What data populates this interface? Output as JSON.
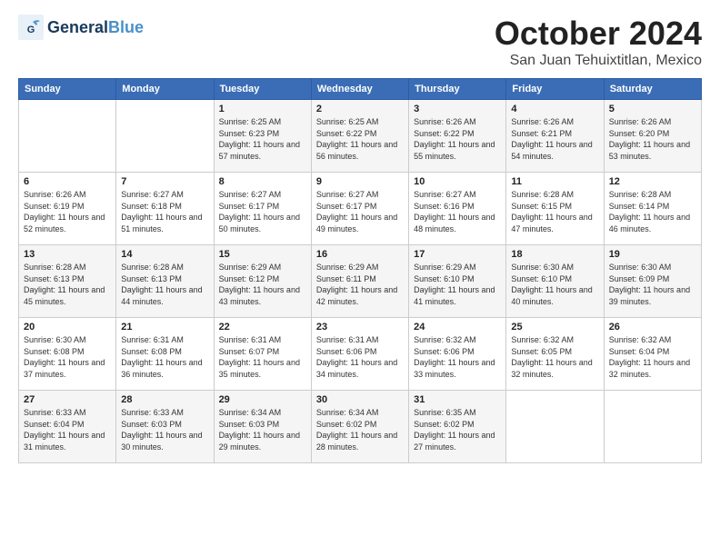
{
  "header": {
    "logo_general": "General",
    "logo_blue": "Blue",
    "month": "October 2024",
    "location": "San Juan Tehuixtitlan, Mexico"
  },
  "days_of_week": [
    "Sunday",
    "Monday",
    "Tuesday",
    "Wednesday",
    "Thursday",
    "Friday",
    "Saturday"
  ],
  "weeks": [
    [
      {
        "day": "",
        "info": ""
      },
      {
        "day": "",
        "info": ""
      },
      {
        "day": "1",
        "info": "Sunrise: 6:25 AM\nSunset: 6:23 PM\nDaylight: 11 hours and 57 minutes."
      },
      {
        "day": "2",
        "info": "Sunrise: 6:25 AM\nSunset: 6:22 PM\nDaylight: 11 hours and 56 minutes."
      },
      {
        "day": "3",
        "info": "Sunrise: 6:26 AM\nSunset: 6:22 PM\nDaylight: 11 hours and 55 minutes."
      },
      {
        "day": "4",
        "info": "Sunrise: 6:26 AM\nSunset: 6:21 PM\nDaylight: 11 hours and 54 minutes."
      },
      {
        "day": "5",
        "info": "Sunrise: 6:26 AM\nSunset: 6:20 PM\nDaylight: 11 hours and 53 minutes."
      }
    ],
    [
      {
        "day": "6",
        "info": "Sunrise: 6:26 AM\nSunset: 6:19 PM\nDaylight: 11 hours and 52 minutes."
      },
      {
        "day": "7",
        "info": "Sunrise: 6:27 AM\nSunset: 6:18 PM\nDaylight: 11 hours and 51 minutes."
      },
      {
        "day": "8",
        "info": "Sunrise: 6:27 AM\nSunset: 6:17 PM\nDaylight: 11 hours and 50 minutes."
      },
      {
        "day": "9",
        "info": "Sunrise: 6:27 AM\nSunset: 6:17 PM\nDaylight: 11 hours and 49 minutes."
      },
      {
        "day": "10",
        "info": "Sunrise: 6:27 AM\nSunset: 6:16 PM\nDaylight: 11 hours and 48 minutes."
      },
      {
        "day": "11",
        "info": "Sunrise: 6:28 AM\nSunset: 6:15 PM\nDaylight: 11 hours and 47 minutes."
      },
      {
        "day": "12",
        "info": "Sunrise: 6:28 AM\nSunset: 6:14 PM\nDaylight: 11 hours and 46 minutes."
      }
    ],
    [
      {
        "day": "13",
        "info": "Sunrise: 6:28 AM\nSunset: 6:13 PM\nDaylight: 11 hours and 45 minutes."
      },
      {
        "day": "14",
        "info": "Sunrise: 6:28 AM\nSunset: 6:13 PM\nDaylight: 11 hours and 44 minutes."
      },
      {
        "day": "15",
        "info": "Sunrise: 6:29 AM\nSunset: 6:12 PM\nDaylight: 11 hours and 43 minutes."
      },
      {
        "day": "16",
        "info": "Sunrise: 6:29 AM\nSunset: 6:11 PM\nDaylight: 11 hours and 42 minutes."
      },
      {
        "day": "17",
        "info": "Sunrise: 6:29 AM\nSunset: 6:10 PM\nDaylight: 11 hours and 41 minutes."
      },
      {
        "day": "18",
        "info": "Sunrise: 6:30 AM\nSunset: 6:10 PM\nDaylight: 11 hours and 40 minutes."
      },
      {
        "day": "19",
        "info": "Sunrise: 6:30 AM\nSunset: 6:09 PM\nDaylight: 11 hours and 39 minutes."
      }
    ],
    [
      {
        "day": "20",
        "info": "Sunrise: 6:30 AM\nSunset: 6:08 PM\nDaylight: 11 hours and 37 minutes."
      },
      {
        "day": "21",
        "info": "Sunrise: 6:31 AM\nSunset: 6:08 PM\nDaylight: 11 hours and 36 minutes."
      },
      {
        "day": "22",
        "info": "Sunrise: 6:31 AM\nSunset: 6:07 PM\nDaylight: 11 hours and 35 minutes."
      },
      {
        "day": "23",
        "info": "Sunrise: 6:31 AM\nSunset: 6:06 PM\nDaylight: 11 hours and 34 minutes."
      },
      {
        "day": "24",
        "info": "Sunrise: 6:32 AM\nSunset: 6:06 PM\nDaylight: 11 hours and 33 minutes."
      },
      {
        "day": "25",
        "info": "Sunrise: 6:32 AM\nSunset: 6:05 PM\nDaylight: 11 hours and 32 minutes."
      },
      {
        "day": "26",
        "info": "Sunrise: 6:32 AM\nSunset: 6:04 PM\nDaylight: 11 hours and 32 minutes."
      }
    ],
    [
      {
        "day": "27",
        "info": "Sunrise: 6:33 AM\nSunset: 6:04 PM\nDaylight: 11 hours and 31 minutes."
      },
      {
        "day": "28",
        "info": "Sunrise: 6:33 AM\nSunset: 6:03 PM\nDaylight: 11 hours and 30 minutes."
      },
      {
        "day": "29",
        "info": "Sunrise: 6:34 AM\nSunset: 6:03 PM\nDaylight: 11 hours and 29 minutes."
      },
      {
        "day": "30",
        "info": "Sunrise: 6:34 AM\nSunset: 6:02 PM\nDaylight: 11 hours and 28 minutes."
      },
      {
        "day": "31",
        "info": "Sunrise: 6:35 AM\nSunset: 6:02 PM\nDaylight: 11 hours and 27 minutes."
      },
      {
        "day": "",
        "info": ""
      },
      {
        "day": "",
        "info": ""
      }
    ]
  ]
}
